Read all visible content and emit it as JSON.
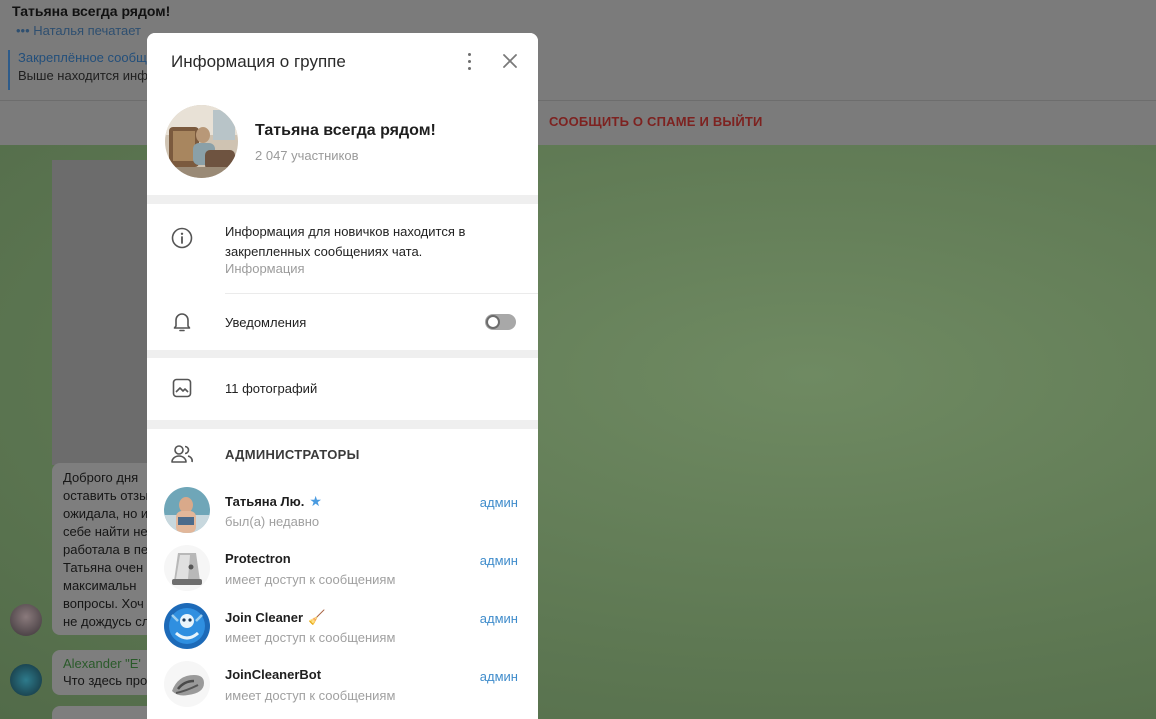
{
  "chat": {
    "title": "Татьяна всегда рядом!",
    "typing": "••• Наталья печатает",
    "pinned_title": "Закреплённое сообщ",
    "pinned_text": "Выше находится инф",
    "spam_button": "СООБЩИТЬ О СПАМЕ И ВЫЙТИ",
    "message_lines": [
      "Доброго дня",
      "оставить отзы",
      "ожидала, но и",
      "себе найти не",
      "работала в пе",
      "Татьяна очен",
      "максимальн",
      "вопросы. Хоч",
      "не дождусь сл"
    ],
    "message2_sender": "Alexander \"E'",
    "message2_text": "Что здесь про"
  },
  "modal": {
    "title": "Информация о группе",
    "group_name": "Татьяна всегда рядом!",
    "members": "2 047 участников",
    "info_text": "Информация для новичков находится в закрепленных сообщениях чата.",
    "info_sub": "Информация",
    "notifications_label": "Уведомления",
    "notifications_enabled": false,
    "photos_label": "11 фотографий",
    "admins_title": "АДМИНИСТРАТОРЫ",
    "admins": [
      {
        "name": "Татьяна Лю.",
        "badge": "★",
        "status": "был(а) недавно",
        "role": "админ"
      },
      {
        "name": "Protectron",
        "badge": "",
        "status": "имеет доступ к сообщениям",
        "role": "админ"
      },
      {
        "name": "Join Cleaner",
        "badge": "🧹",
        "status": "имеет доступ к сообщениям",
        "role": "админ"
      },
      {
        "name": "JoinCleanerBot",
        "badge": "",
        "status": "имеет доступ к сообщениям",
        "role": "админ"
      }
    ]
  },
  "icons": [
    "more-vertical-icon",
    "close-icon",
    "info-icon",
    "bell-icon",
    "photo-icon",
    "people-icon",
    "star-icon"
  ],
  "colors": {
    "accent": "#3f8ccb",
    "spam": "#d0413e",
    "modal_bg": "#ffffff",
    "overlay_chat": "#5d7752"
  }
}
